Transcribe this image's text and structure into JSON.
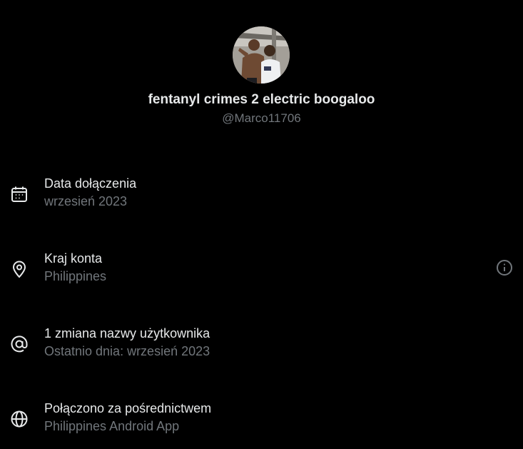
{
  "profile": {
    "display_name": "fentanyl crimes 2 electric boogaloo",
    "handle": "@Marco11706",
    "avatar_icon": "profile-photo-avatar"
  },
  "about": [
    {
      "icon": "calendar-icon",
      "title": "Data dołączenia",
      "subtitle": "wrzesień 2023"
    },
    {
      "icon": "location-pin-icon",
      "title": "Kraj konta",
      "subtitle": "Philippines",
      "action_icon": "info-icon"
    },
    {
      "icon": "at-sign-icon",
      "title": "1 zmiana nazwy użytkownika",
      "subtitle": "Ostatnio dnia: wrzesień 2023"
    },
    {
      "icon": "globe-icon",
      "title": "Połączono za pośrednictwem",
      "subtitle": "Philippines Android App"
    }
  ],
  "colors": {
    "background": "#000000",
    "primary_text": "#e7e9ea",
    "secondary_text": "#71767b"
  }
}
